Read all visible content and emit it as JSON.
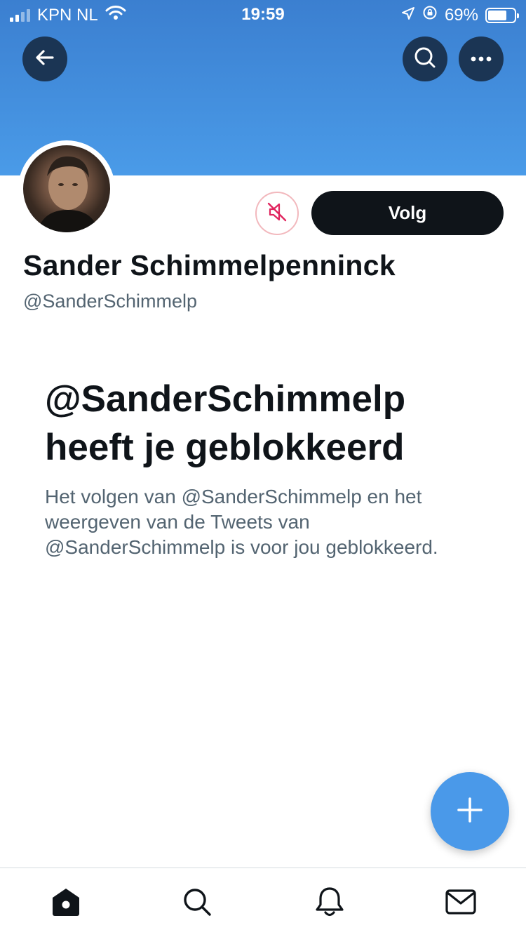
{
  "status_bar": {
    "carrier": "KPN NL",
    "time": "19:59",
    "battery": "69%",
    "battery_level": 0.69
  },
  "header": {
    "back_icon": "arrow-left-icon",
    "search_icon": "search-icon",
    "more_icon": "more-horizontal-icon"
  },
  "profile": {
    "name": "Sander Schimmelpenninck",
    "handle": "@SanderSchimmelp",
    "follow_label": "Volg",
    "mute_icon": "muted-speaker-icon"
  },
  "blocked": {
    "title": "@SanderSchimmelp heeft je geblokkeerd",
    "description": "Het volgen van @SanderSchimmelp en het weergeven van de Tweets van @SanderSchimmelp is voor jou geblokkeerd."
  },
  "fab": {
    "icon": "plus-icon"
  },
  "tabbar": {
    "items": [
      "home-icon",
      "search-icon",
      "bell-icon",
      "mail-icon"
    ]
  },
  "colors": {
    "banner": "#4a9be8",
    "accent": "#4a99e9",
    "dark": "#0f1419",
    "muted_text": "#536471",
    "mute_red": "#e0245e"
  }
}
